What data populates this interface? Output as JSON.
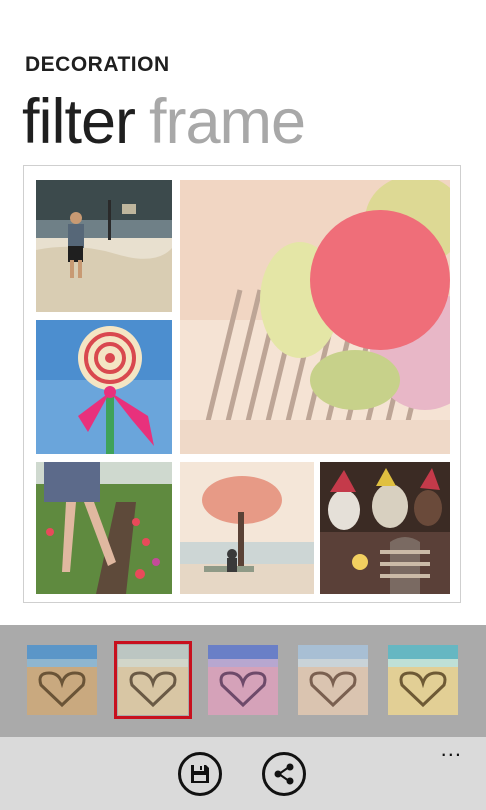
{
  "app": {
    "title": "DECORATION"
  },
  "pivot": {
    "items": [
      {
        "label": "filter"
      },
      {
        "label": "frame"
      }
    ]
  },
  "collage": {
    "photos": [
      {
        "icon": "beach-child-photo"
      },
      {
        "icon": "balloons-photo"
      },
      {
        "icon": "lollipop-photo"
      },
      {
        "icon": "garden-legs-photo"
      },
      {
        "icon": "tree-bench-photo"
      },
      {
        "icon": "party-masks-photo"
      }
    ]
  },
  "filters": {
    "thumbnails": [
      {
        "icon": "heart-sand-filter-1"
      },
      {
        "icon": "heart-sand-filter-2",
        "selected": true
      },
      {
        "icon": "heart-sand-filter-3"
      },
      {
        "icon": "heart-sand-filter-4"
      },
      {
        "icon": "heart-sand-filter-5"
      }
    ],
    "selected_border_color": "#c8101e"
  },
  "appbar": {
    "buttons": [
      {
        "icon": "save-icon"
      },
      {
        "icon": "share-icon"
      }
    ],
    "more_label": "..."
  }
}
